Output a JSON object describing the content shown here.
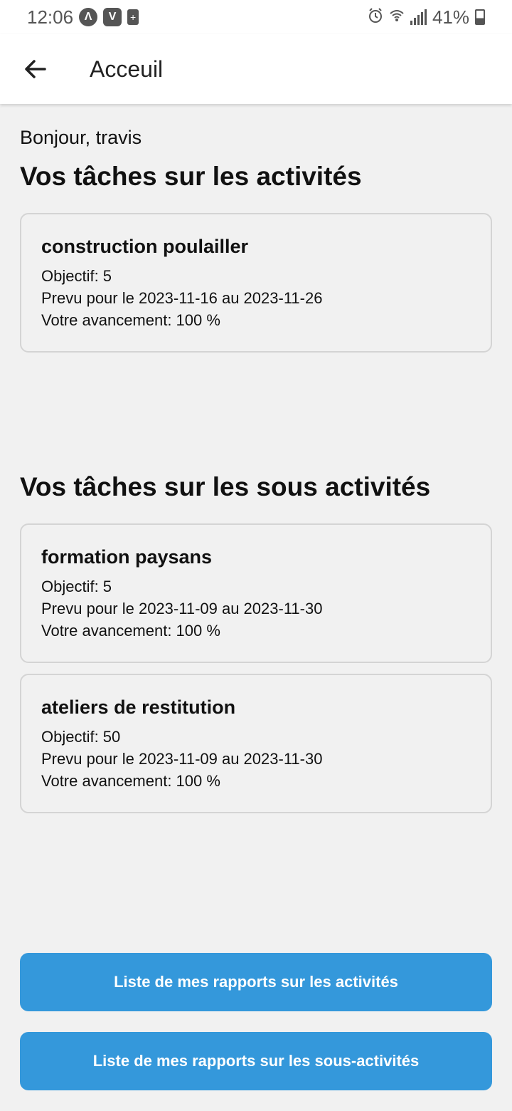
{
  "status_bar": {
    "time": "12:06",
    "battery_percent": "41%",
    "notif_icons": [
      "Λ",
      "V"
    ]
  },
  "app_bar": {
    "title": "Acceuil"
  },
  "greeting": "Bonjour, travis",
  "activities": {
    "section_title": "Vos tâches sur les activités",
    "items": [
      {
        "title": "construction poulailler",
        "objectif": "Objectif: 5",
        "prevu": "Prevu pour le 2023-11-16 au 2023-11-26",
        "avancement": "Votre avancement: 100 %"
      }
    ]
  },
  "sous_activities": {
    "section_title": "Vos tâches sur les sous activités",
    "items": [
      {
        "title": "formation paysans",
        "objectif": "Objectif: 5",
        "prevu": "Prevu pour le 2023-11-09 au 2023-11-30",
        "avancement": "Votre avancement: 100 %"
      },
      {
        "title": "ateliers de restitution",
        "objectif": "Objectif: 50",
        "prevu": "Prevu pour le 2023-11-09 au 2023-11-30",
        "avancement": "Votre avancement: 100 %"
      }
    ]
  },
  "buttons": {
    "rapports_activites": "Liste de mes rapports sur les activités",
    "rapports_sous_activites": "Liste de mes rapports sur les sous-activités"
  },
  "colors": {
    "accent": "#3498db",
    "background": "#f1f1f1",
    "card_border": "#d4d4d4"
  }
}
